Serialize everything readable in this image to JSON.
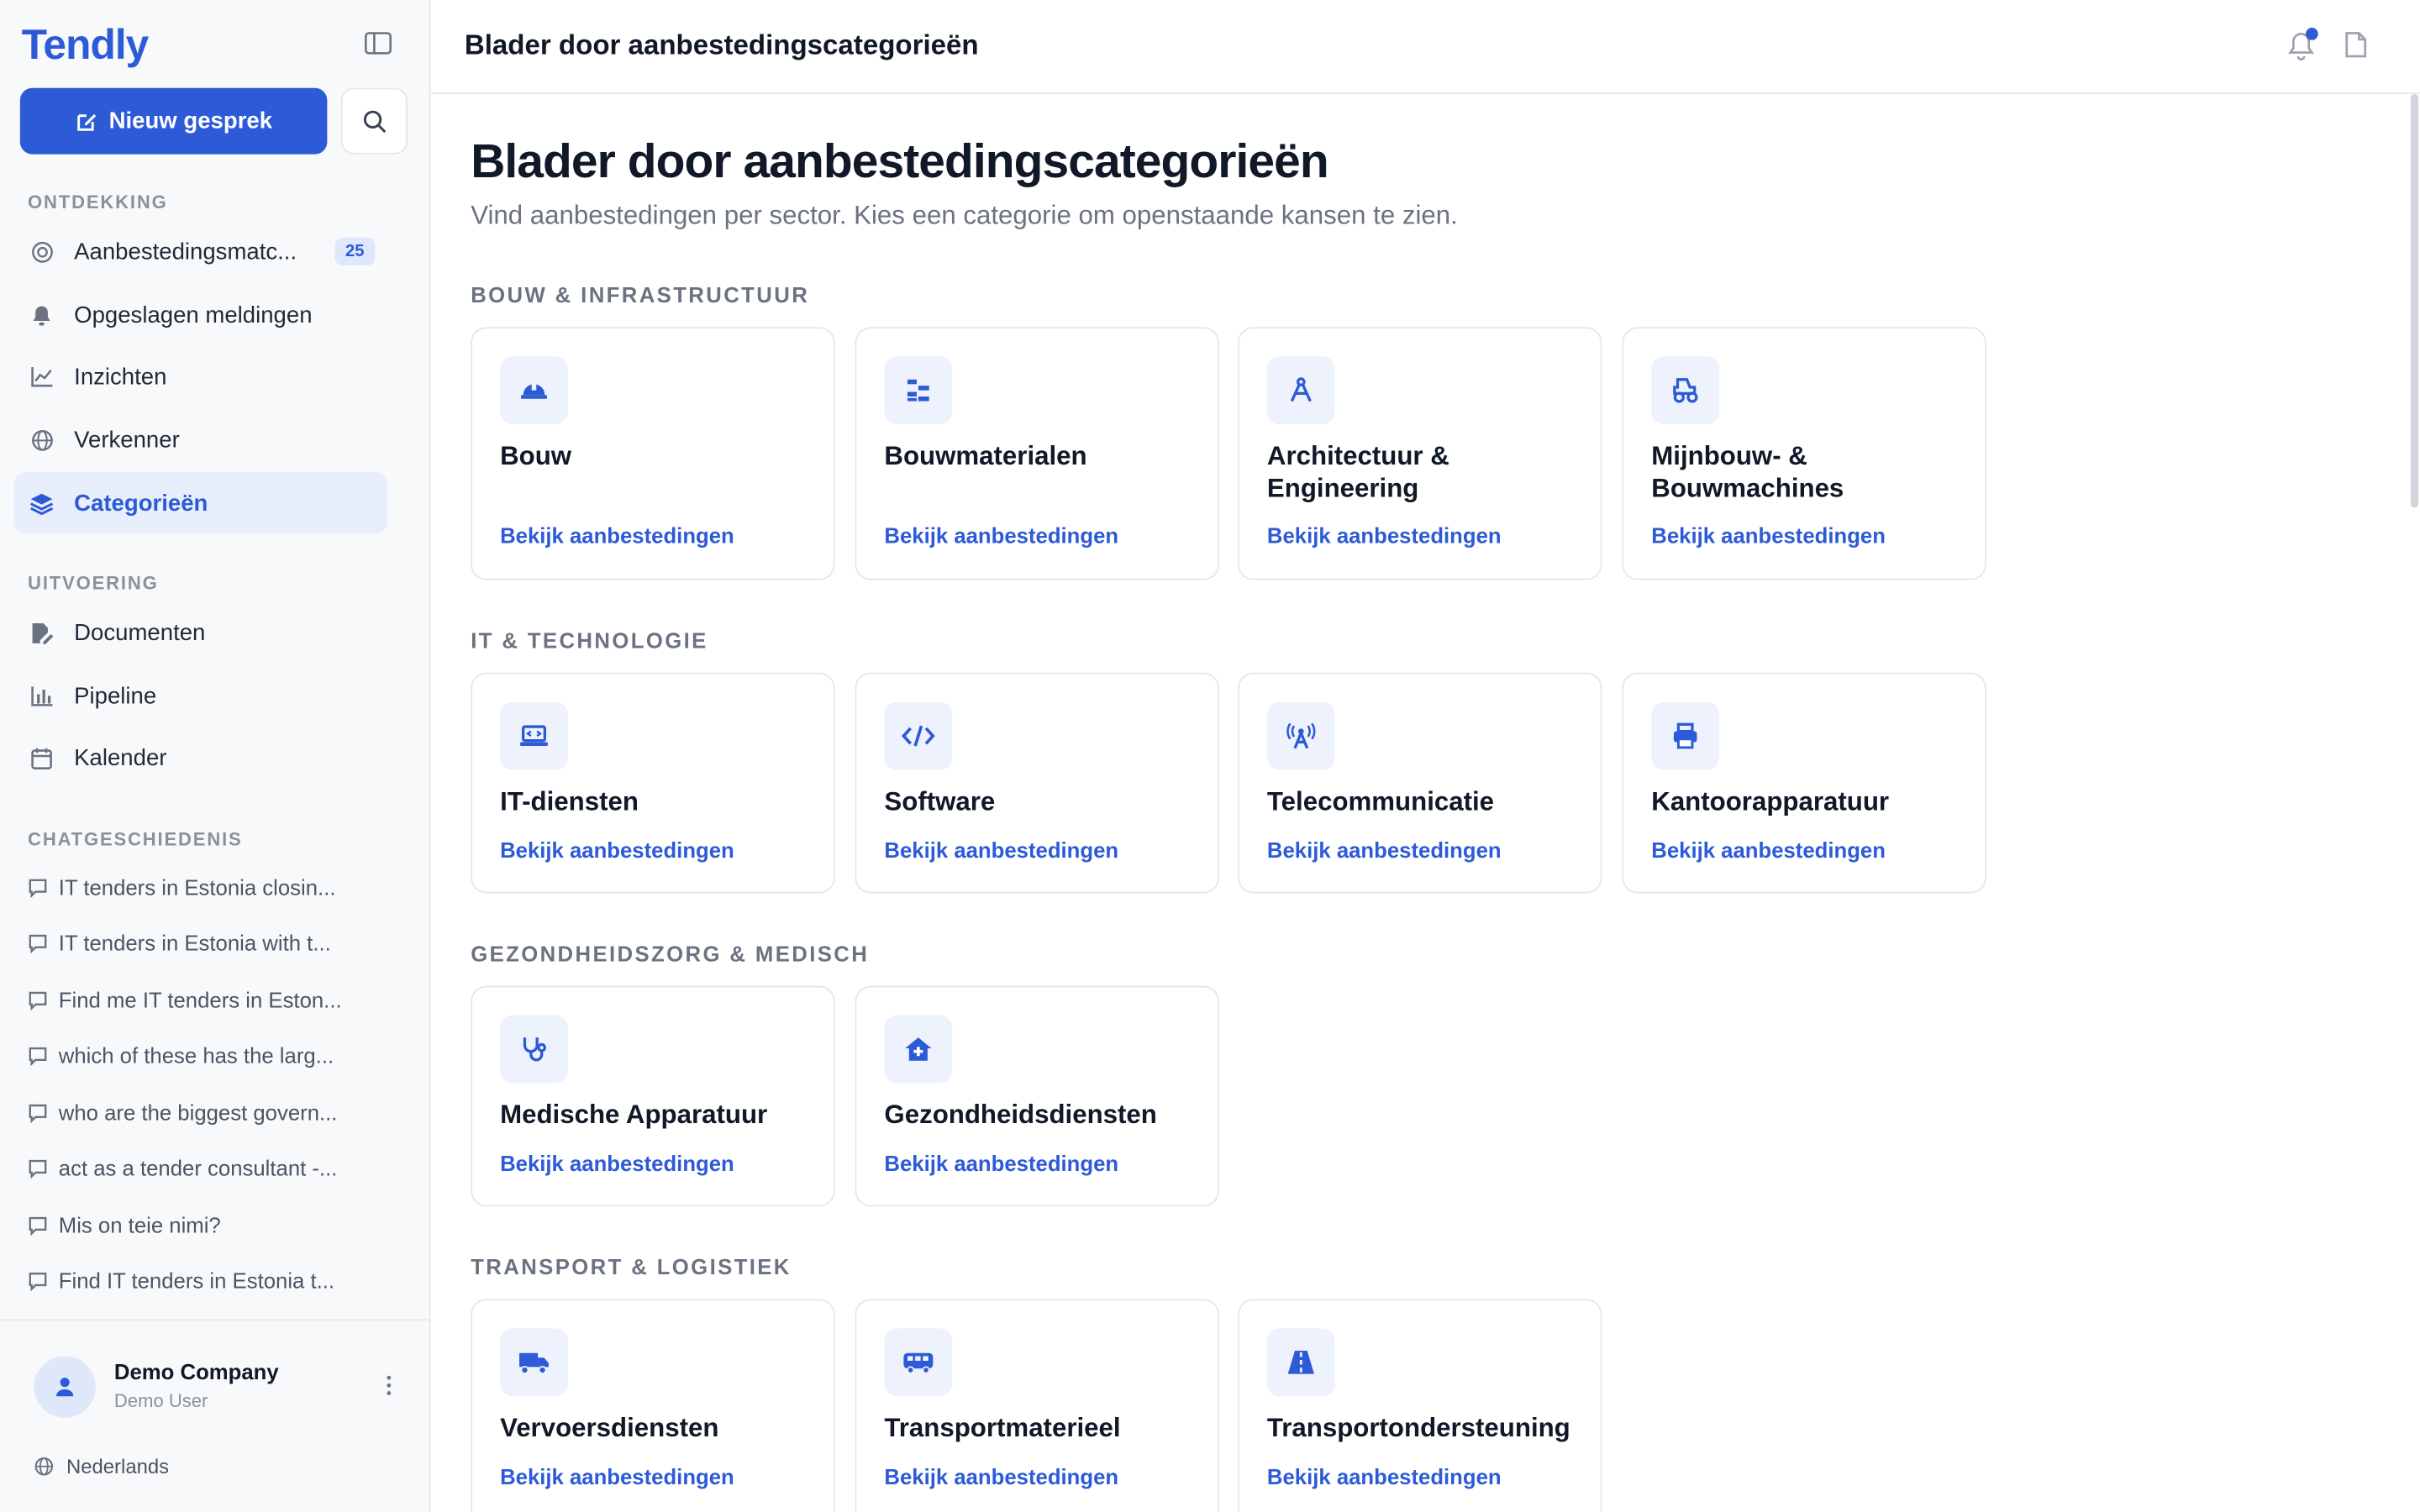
{
  "app": {
    "logo": "Tendly"
  },
  "sidebar": {
    "new_chat_label": "Nieuw gesprek",
    "sections": {
      "discovery": "ONTDEKKING",
      "execution": "UITVOERING",
      "history": "CHATGESCHIEDENIS"
    },
    "discovery_items": [
      {
        "label": "Aanbestedingsmatc...",
        "badge": "25"
      },
      {
        "label": "Opgeslagen meldingen"
      },
      {
        "label": "Inzichten"
      },
      {
        "label": "Verkenner"
      },
      {
        "label": "Categorieën"
      }
    ],
    "execution_items": [
      {
        "label": "Documenten"
      },
      {
        "label": "Pipeline"
      },
      {
        "label": "Kalender"
      }
    ],
    "history": [
      "IT tenders in Estonia closin...",
      "IT tenders in Estonia with t...",
      "Find me IT tenders in Eston...",
      "which of these has the larg...",
      "who are the biggest govern...",
      "act as a tender consultant -...",
      "Mis on teie nimi?",
      "Find IT tenders in Estonia t..."
    ],
    "user": {
      "name": "Demo Company",
      "role": "Demo User"
    },
    "language": "Nederlands"
  },
  "header": {
    "title": "Blader door aanbestedingscategorieën"
  },
  "main": {
    "title": "Blader door aanbestedingscategorieën",
    "subtitle": "Vind aanbestedingen per sector. Kies een categorie om openstaande kansen te zien.",
    "link_label": "Bekijk aanbestedingen",
    "groups": [
      {
        "name": "BOUW & INFRASTRUCTUUR",
        "cards": [
          {
            "name": "Bouw",
            "icon": "helmet-icon"
          },
          {
            "name": "Bouwmaterialen",
            "icon": "materials-icon"
          },
          {
            "name": "Architectuur & Engineering",
            "icon": "compass-icon"
          },
          {
            "name": "Mijnbouw- & Bouwmachines",
            "icon": "tractor-icon"
          }
        ]
      },
      {
        "name": "IT & TECHNOLOGIE",
        "cards": [
          {
            "name": "IT-diensten",
            "icon": "laptop-icon"
          },
          {
            "name": "Software",
            "icon": "code-icon"
          },
          {
            "name": "Telecommunicatie",
            "icon": "tower-icon"
          },
          {
            "name": "Kantoorapparatuur",
            "icon": "printer-icon"
          }
        ]
      },
      {
        "name": "GEZONDHEIDSZORG & MEDISCH",
        "cards": [
          {
            "name": "Medische Apparatuur",
            "icon": "stethoscope-icon"
          },
          {
            "name": "Gezondheidsdiensten",
            "icon": "clinic-icon"
          }
        ]
      },
      {
        "name": "TRANSPORT & LOGISTIEK",
        "cards": [
          {
            "name": "Vervoersdiensten",
            "icon": "truck-icon"
          },
          {
            "name": "Transportmaterieel",
            "icon": "van-icon"
          },
          {
            "name": "Transportondersteuning",
            "icon": "road-icon"
          }
        ]
      }
    ]
  },
  "colors": {
    "accent": "#2d5bd7",
    "accent_soft": "#eef2fc",
    "sidebar_bg": "#f8f9fb"
  }
}
